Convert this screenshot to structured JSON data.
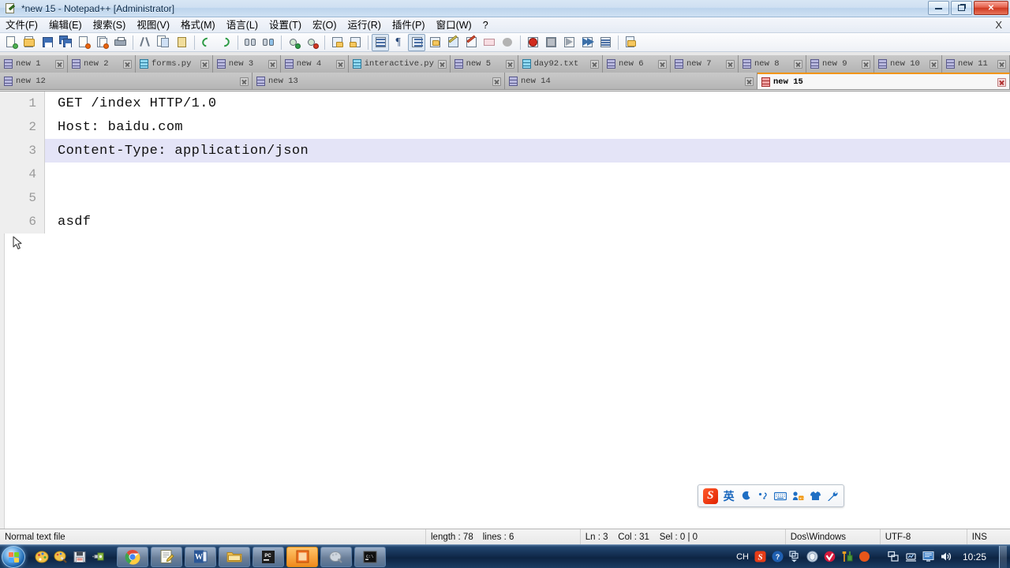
{
  "window": {
    "title": "*new 15 - Notepad++ [Administrator]",
    "icon": "notepad-plus-plus-icon",
    "minimize_label": "Minimize",
    "maximize_label": "Restore",
    "close_label": "Close"
  },
  "menubar": {
    "items": [
      {
        "label": "文件(F)",
        "name": "menu-file"
      },
      {
        "label": "编辑(E)",
        "name": "menu-edit"
      },
      {
        "label": "搜索(S)",
        "name": "menu-search"
      },
      {
        "label": "视图(V)",
        "name": "menu-view"
      },
      {
        "label": "格式(M)",
        "name": "menu-format"
      },
      {
        "label": "语言(L)",
        "name": "menu-language"
      },
      {
        "label": "设置(T)",
        "name": "menu-settings"
      },
      {
        "label": "宏(O)",
        "name": "menu-macro"
      },
      {
        "label": "运行(R)",
        "name": "menu-run"
      },
      {
        "label": "插件(P)",
        "name": "menu-plugins"
      },
      {
        "label": "窗口(W)",
        "name": "menu-window"
      },
      {
        "label": "?",
        "name": "menu-help"
      }
    ],
    "close_document_label": "X"
  },
  "toolbar": {
    "buttons": [
      "new-file-icon",
      "open-file-icon",
      "save-icon",
      "save-all-icon",
      "close-file-icon",
      "close-all-icon",
      "print-icon",
      "sep",
      "cut-icon",
      "copy-icon",
      "paste-icon",
      "sep",
      "undo-icon",
      "redo-icon",
      "sep",
      "find-icon",
      "replace-icon",
      "sep",
      "zoom-in-icon",
      "zoom-out-icon",
      "sep",
      "sync-vertical-scroll-icon",
      "sync-horizontal-scroll-icon",
      "sep",
      "word-wrap-icon",
      "show-all-chars-icon",
      "indent-guide-icon",
      "user-defined-dialog-icon",
      "show-doc-map-icon",
      "doc-switcher-icon",
      "function-list-icon",
      "folder-as-workspace-icon",
      "sep",
      "macro-record-icon",
      "macro-stop-icon",
      "macro-playback-icon",
      "macro-run-multiple-icon",
      "macro-save-icon",
      "sep",
      "run-icon"
    ]
  },
  "tabs": {
    "row1": [
      {
        "label": "new 1",
        "icon": "unsaved-doc-icon",
        "active": false
      },
      {
        "label": "new 2",
        "icon": "unsaved-doc-icon",
        "active": false
      },
      {
        "label": "forms.py",
        "icon": "saved-doc-icon",
        "active": false
      },
      {
        "label": "new 3",
        "icon": "unsaved-doc-icon",
        "active": false
      },
      {
        "label": "new 4",
        "icon": "unsaved-doc-icon",
        "active": false
      },
      {
        "label": "interactive.py",
        "icon": "saved-doc-icon",
        "active": false
      },
      {
        "label": "new 5",
        "icon": "unsaved-doc-icon",
        "active": false
      },
      {
        "label": "day92.txt",
        "icon": "saved-doc-icon",
        "active": false
      },
      {
        "label": "new 6",
        "icon": "unsaved-doc-icon",
        "active": false
      },
      {
        "label": "new 7",
        "icon": "unsaved-doc-icon",
        "active": false
      },
      {
        "label": "new 8",
        "icon": "unsaved-doc-icon",
        "active": false
      },
      {
        "label": "new 9",
        "icon": "unsaved-doc-icon",
        "active": false
      },
      {
        "label": "new 10",
        "icon": "unsaved-doc-icon",
        "active": false
      },
      {
        "label": "new 11",
        "icon": "unsaved-doc-icon",
        "active": false
      }
    ],
    "row2": [
      {
        "label": "new 12",
        "icon": "unsaved-doc-icon",
        "active": false
      },
      {
        "label": "new 13",
        "icon": "unsaved-doc-icon",
        "active": false
      },
      {
        "label": "new 14",
        "icon": "unsaved-doc-icon",
        "active": false
      },
      {
        "label": "new 15",
        "icon": "modified-doc-icon",
        "active": true
      }
    ],
    "active_accent_color": "#f29400"
  },
  "editor": {
    "lines": [
      {
        "number": "1",
        "text": "GET /index HTTP/1.0",
        "current": false
      },
      {
        "number": "2",
        "text": "Host: baidu.com",
        "current": false
      },
      {
        "number": "3",
        "text": "Content-Type: application/json",
        "current": true
      },
      {
        "number": "4",
        "text": "",
        "current": false
      },
      {
        "number": "5",
        "text": "",
        "current": false
      },
      {
        "number": "6",
        "text": "asdf",
        "current": false
      }
    ],
    "current_line_color": "#e4e4f7",
    "background_color": "#ffffff",
    "gutter_color": "#eeeeee",
    "cursor_icon": "mouse-pointer-icon"
  },
  "ime": {
    "logo": "sogou-logo-icon",
    "items": [
      {
        "glyph": "英",
        "name": "ime-english-mode-icon"
      },
      {
        "glyph": "☽",
        "name": "ime-moon-icon"
      },
      {
        "glyph": "‚，",
        "name": "ime-punctuation-icon"
      },
      {
        "glyph": "⌨",
        "name": "ime-soft-keyboard-icon"
      },
      {
        "glyph": "⌸",
        "name": "ime-input-method-icon"
      },
      {
        "glyph": "👕",
        "name": "ime-skin-icon"
      },
      {
        "glyph": "🔧",
        "name": "ime-toolbox-icon"
      }
    ]
  },
  "statusbar": {
    "file_type": "Normal text file",
    "length": "length : 78",
    "lines": "lines : 6",
    "ln": "Ln : 3",
    "col": "Col : 31",
    "sel": "Sel : 0 | 0",
    "eol": "Dos\\Windows",
    "encoding": "UTF-8",
    "insert_mode": "INS"
  },
  "taskbar": {
    "start_label": "Start",
    "quicklaunch": [
      {
        "name": "paint-palette-icon"
      },
      {
        "name": "paint-brush-icon"
      },
      {
        "name": "save-floppy-icon"
      },
      {
        "name": "connect-plug-icon"
      }
    ],
    "tasks": [
      {
        "name": "task-chrome",
        "active": false
      },
      {
        "name": "task-notepad-plus-plus",
        "active": false,
        "light": true
      },
      {
        "name": "task-word",
        "active": false
      },
      {
        "name": "task-explorer",
        "active": false
      },
      {
        "name": "task-pycharm",
        "active": false
      },
      {
        "name": "task-current-window",
        "active": true
      },
      {
        "name": "task-paint",
        "active": false
      },
      {
        "name": "task-cmd",
        "active": false
      }
    ],
    "tray": {
      "language": "CH",
      "icons": [
        {
          "name": "sogou-tray-icon"
        },
        {
          "name": "help-question-icon"
        },
        {
          "name": "show-hidden-icons-icon"
        },
        {
          "name": "security-shield-icon"
        },
        {
          "name": "antivirus-icon"
        },
        {
          "name": "tools-icon"
        },
        {
          "name": "recording-icon"
        },
        {
          "name": "safely-remove-hardware-icon"
        },
        {
          "name": "network-monitor-icon"
        },
        {
          "name": "display-icon"
        },
        {
          "name": "volume-icon"
        }
      ],
      "clock": "10:25"
    }
  }
}
